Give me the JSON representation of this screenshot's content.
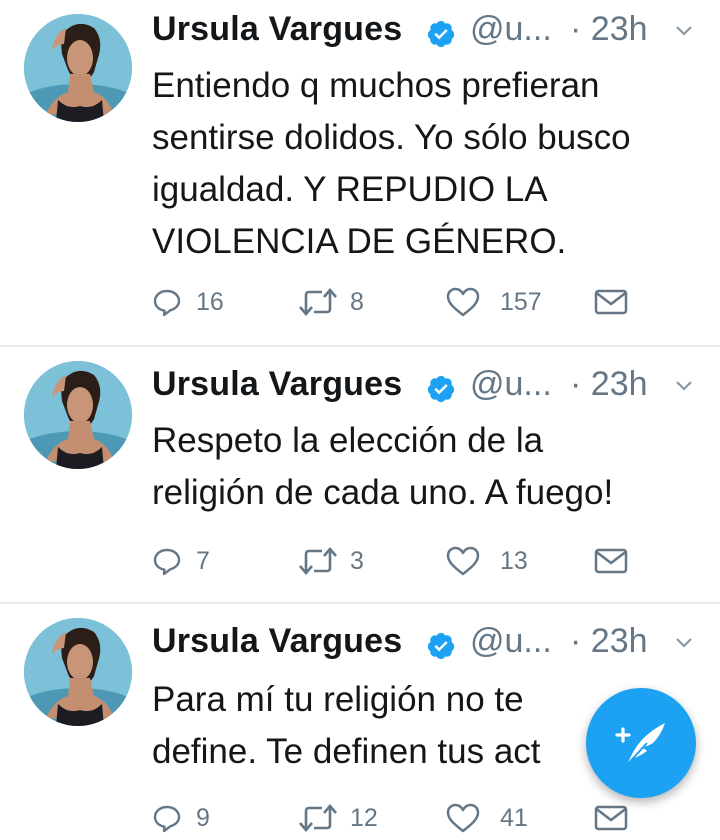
{
  "colors": {
    "accent": "#1da1f2",
    "secondary_text": "#657786",
    "separator": "#e6ecf0"
  },
  "tweets": [
    {
      "author": "Ursula Vargues",
      "handle": "@u...",
      "dot": "·",
      "time": "23h",
      "text_lines": [
        "Entiendo q muchos prefieran",
        "sentirse dolidos. Yo sólo busco",
        "igualdad. Y REPUDIO LA",
        "VIOLENCIA DE GÉNERO."
      ],
      "replies": "16",
      "retweets": "8",
      "likes": "157"
    },
    {
      "author": "Ursula Vargues",
      "handle": "@u...",
      "dot": "·",
      "time": "23h",
      "text_lines": [
        "Respeto la elección de la",
        "religión de cada uno. A fuego!"
      ],
      "replies": "7",
      "retweets": "3",
      "likes": "13"
    },
    {
      "author": "Ursula Vargues",
      "handle": "@u...",
      "dot": "·",
      "time": "23h",
      "text_lines": [
        "Para mí tu religión no te",
        "define. Te definen tus act"
      ],
      "replies": "9",
      "retweets": "12",
      "likes": "41"
    }
  ],
  "icons": {
    "verified": "verified-badge-icon",
    "caret": "chevron-down-icon",
    "reply": "reply-icon",
    "retweet": "retweet-icon",
    "like": "heart-icon",
    "dm": "envelope-icon",
    "compose": "compose-tweet-icon"
  }
}
